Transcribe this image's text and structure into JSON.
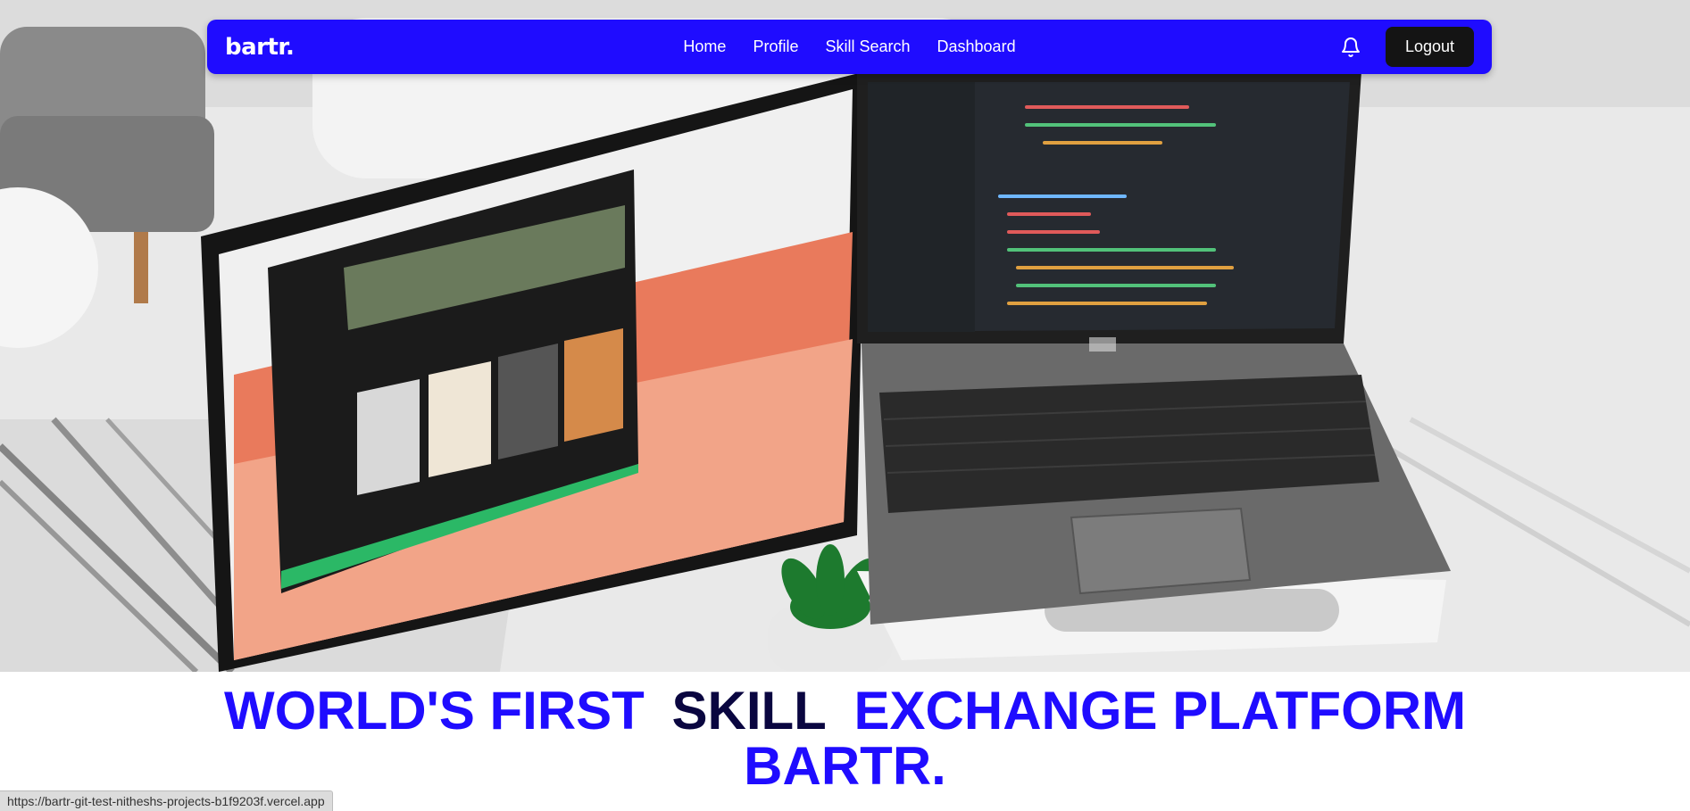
{
  "navbar": {
    "logo": "bartr.",
    "links": [
      "Home",
      "Profile",
      "Skill Search",
      "Dashboard"
    ],
    "logout_label": "Logout",
    "icon": "bell-icon"
  },
  "hero": {
    "image": "desk-with-monitor-and-laptop-photo"
  },
  "headline": {
    "part1": "WORLD'S FIRST",
    "part2": "SKILL",
    "part3": "EXCHANGE PLATFORM",
    "line2": "BARTR."
  },
  "status_url": "https://bartr-git-test-nitheshs-projects-b1f9203f.vercel.app",
  "colors": {
    "brand": "#1f0cff",
    "dark_accent": "#0a0640",
    "logout_bg": "#141414"
  }
}
